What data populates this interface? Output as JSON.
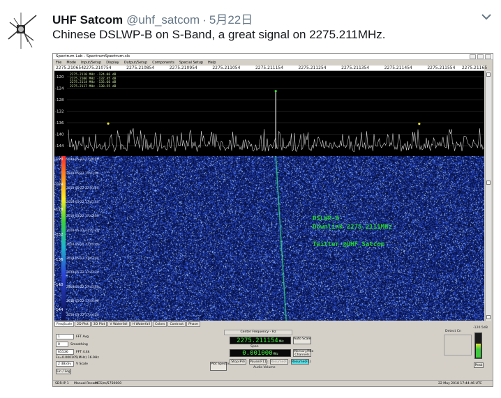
{
  "tweet": {
    "display_name": "UHF Satcom",
    "handle": "@uhf_satcom",
    "separator": "·",
    "date": "5月22日",
    "text": "Chinese DSLWP-B on S-Band, a great signal on 2275.211MHz."
  },
  "icons": {
    "avatar": "satellite-icon",
    "caret": "chevron-down-icon"
  },
  "app": {
    "title": "Spectrum Lab - SpectrumSpectrum.sls",
    "menu": [
      "File",
      "Mode",
      "Input/Setup",
      "Display",
      "Output/Setup",
      "Components",
      "Special Setup",
      "Help"
    ],
    "freq_ticks": [
      "2275.210654",
      "2275.210754",
      "2275.210854",
      "2275.210954",
      "2275.211054",
      "2275.211154",
      "2275.211254",
      "2275.211354",
      "2275.211454",
      "2275.211554",
      "2275.21165"
    ],
    "spectrum_db_labels": [
      "-120",
      "-124",
      "-128",
      "-132",
      "-136",
      "-140",
      "-144"
    ],
    "marker_lines": [
      "2275.2110 MHz  -124.06 dB",
      "2275.2106 MHz  -132.45 dB",
      "2275.2114 MHz  -135.66 dB",
      "2275.2117 MHz  -138.55 dB"
    ],
    "waterfall_db_labels": [
      "-120",
      "-124",
      "-128",
      "-132",
      "-136",
      "-140",
      "-144"
    ],
    "timestamps": [
      "2018-05-22 17:40:40",
      "2018-05-22 17:41:00",
      "2018-05-22 17:41:20",
      "2018-05-22 17:41:40",
      "2018-05-22 17:42:00",
      "2018-05-22 17:42:20",
      "2018-05-22 17:42:40",
      "2018-05-22 17:43:00",
      "2018-05-22 17:43:20",
      "2018-05-22 17:43:40",
      "2018-05-22 17:44:00",
      "2018-05-22 17:44:20"
    ],
    "overlay_line1": "DSLWP-B",
    "overlay_line2": "Downlink 2275.2111MHz",
    "overlay_line3": "Twitter @UHF_Satcom",
    "tabs": [
      "FreqScale",
      "2D Plot",
      "3D Plot",
      "V Waterfall",
      "H Waterfall",
      "Colors",
      "Contrast",
      "Phase"
    ],
    "fft_avg_label": "FFT Avg",
    "fft_avg_value": "1",
    "smoothing_label": "Smoothing",
    "smoothing_value": "0",
    "fft_label": "FFT 4.4k",
    "fft_value": "65536",
    "freq_info": "Fs=0.000105(MHz) 16.9Hz",
    "vscale_label": "V Scale",
    "vscale_value": "2 dB/div",
    "lin_btn": "Lin / Log",
    "center_freq_caption": "Center Frequency  - Hz",
    "center_freq_value": "2275.211154",
    "center_freq_unit": "MHz",
    "auto_scale_btn": "Auto Scale",
    "span_caption": "Span",
    "span_value": "0.001000",
    "span_unit": "MHz",
    "memory_btn": "Memory/Mix",
    "memory_sub": "Channels",
    "plot_spectrum_btn": "Plot Spectrum",
    "stop_btn": "Stop(F9)",
    "pause_btn": "Pause(F11)",
    "resume_btn": "Resume(F1)",
    "audio_volume": "Audio Volume",
    "detect_label": "Detect Cn",
    "meter_caption": "-120.5dB",
    "peak_label": "Peak",
    "status_left": "SDR-IP 1",
    "status_mid": "Manual Record",
    "status_right_pos": "MCS/m/5750000",
    "status_time": "22 May 2018  17:44:46 UTC"
  },
  "chart_data": {
    "type": "line",
    "title": "",
    "xlabel": "",
    "ylabel": "",
    "ylim": [
      -146,
      -118
    ],
    "x_range_mhz": [
      2275.210654,
      2275.21165
    ],
    "peak": {
      "x": 2275.211154,
      "y": -124.06
    },
    "secondary_markers": [
      {
        "x": 2275.21075,
        "y": -135.5
      },
      {
        "x": 2275.2115,
        "y": -135.6
      }
    ],
    "noise_floor_db": -142
  },
  "colors": {
    "waterfall_bg": "#0b1a55",
    "trace": "#d0d0d0",
    "signal_line": "#36e088",
    "overlay_text": "#22d32c",
    "lcd_text": "#3cf03c"
  }
}
